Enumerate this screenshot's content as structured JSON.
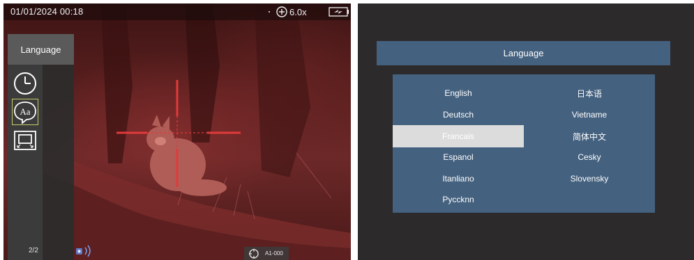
{
  "status_bar": {
    "datetime": "01/01/2024  00:18",
    "zoom": "6.0x",
    "icons": {
      "mode": "moon-icon",
      "zoom": "zoom-plus-icon",
      "battery": "battery-charging-icon"
    }
  },
  "menu": {
    "title": "Language",
    "items": [
      {
        "icon": "clock-icon",
        "selected": false
      },
      {
        "icon": "language-aa-icon",
        "selected": true
      },
      {
        "icon": "display-screen-icon",
        "selected": false
      }
    ],
    "page": "2/2"
  },
  "bottom_bar": {
    "wifi_icon": "wifi-icon",
    "target_icon": "target-icon",
    "record_label": "A1-000"
  },
  "language_screen": {
    "title": "Language",
    "selected": "Francais",
    "columns": [
      [
        "English",
        "Deutsch",
        "Francais",
        "Espanol",
        "Itanliano",
        "Pyccknn"
      ],
      [
        "日本语",
        "Vietname",
        "简体中文",
        "Cesky",
        "Slovensky"
      ]
    ]
  },
  "colors": {
    "reticle": "#e03a3a",
    "menu_bg": "#44617f",
    "selected_bg": "#dcdcdc",
    "screen_bg": "#2d2a2c"
  }
}
